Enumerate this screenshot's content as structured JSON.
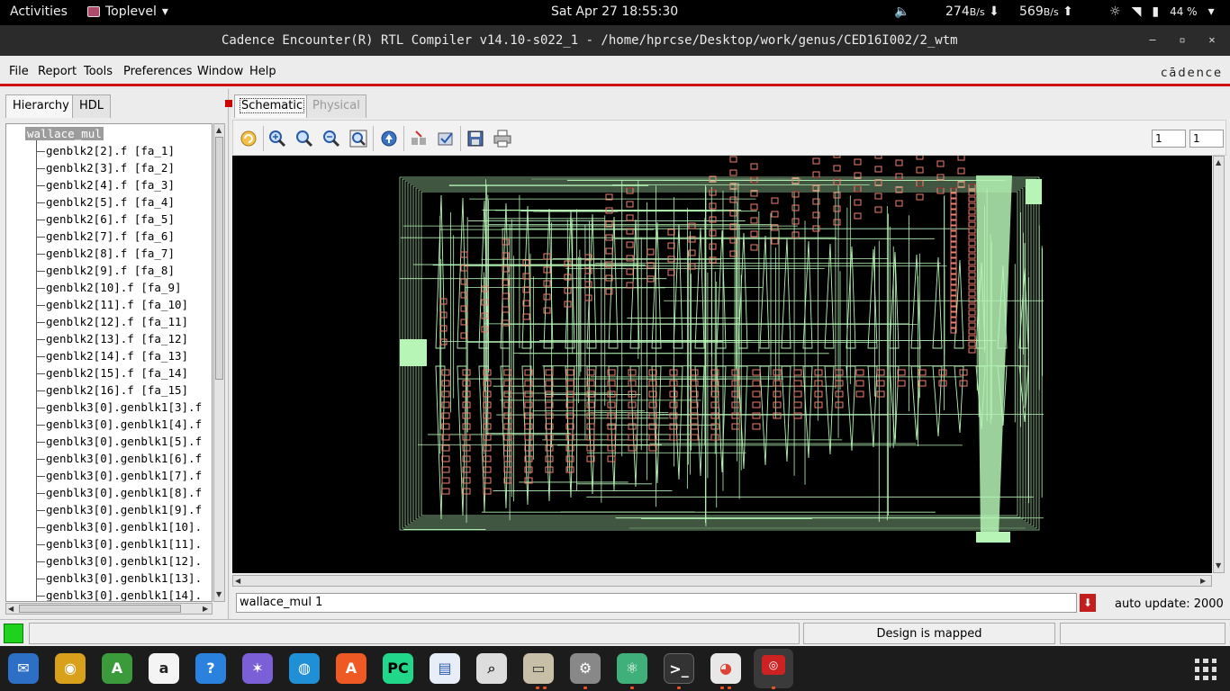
{
  "topbar": {
    "activities": "Activities",
    "app_menu": "Toplevel",
    "clock": "Sat Apr 27  18:55:30",
    "net_down": "274",
    "net_down_unit": "B/s",
    "net_up": "569",
    "net_up_unit": "B/s",
    "battery": "44 %"
  },
  "window": {
    "title": "Cadence Encounter(R) RTL Compiler v14.10-s022_1 - /home/hprcse/Desktop/work/genus/CED16I002/2_wtm"
  },
  "menubar": {
    "file": "File",
    "report": "Report",
    "tools": "Tools",
    "preferences": "Preferences",
    "window": "Window",
    "help": "Help",
    "logo": "cādence"
  },
  "left_panel": {
    "tabs": [
      "Hierarchy",
      "HDL"
    ],
    "root": "wallace_mul",
    "nodes": [
      "genblk2[2].f [fa_1]",
      "genblk2[3].f [fa_2]",
      "genblk2[4].f [fa_3]",
      "genblk2[5].f [fa_4]",
      "genblk2[6].f [fa_5]",
      "genblk2[7].f [fa_6]",
      "genblk2[8].f [fa_7]",
      "genblk2[9].f [fa_8]",
      "genblk2[10].f [fa_9]",
      "genblk2[11].f [fa_10]",
      "genblk2[12].f [fa_11]",
      "genblk2[13].f [fa_12]",
      "genblk2[14].f [fa_13]",
      "genblk2[15].f [fa_14]",
      "genblk2[16].f [fa_15]",
      "genblk3[0].genblk1[3].f",
      "genblk3[0].genblk1[4].f",
      "genblk3[0].genblk1[5].f",
      "genblk3[0].genblk1[6].f",
      "genblk3[0].genblk1[7].f",
      "genblk3[0].genblk1[8].f",
      "genblk3[0].genblk1[9].f",
      "genblk3[0].genblk1[10].",
      "genblk3[0].genblk1[11].",
      "genblk3[0].genblk1[12].",
      "genblk3[0].genblk1[13].",
      "genblk3[0].genblk1[14]."
    ]
  },
  "right_panel": {
    "tabs": [
      "Schematic",
      "Physical"
    ],
    "spin1": "1",
    "spin2": "1",
    "command": "wallace_mul 1",
    "auto_update": "auto update: 2000"
  },
  "statusbar": {
    "message": "Design is mapped"
  },
  "colors": {
    "wire": "#b6f5b6",
    "cell": "#f08070",
    "canvas": "#000000",
    "accent_red": "#d01010"
  },
  "icons": [
    "refresh-icon",
    "zoom-in-icon",
    "zoom-icon",
    "zoom-out-icon",
    "zoom-fit-icon",
    "go-up-icon",
    "select-icon",
    "check-icon",
    "save-icon",
    "print-icon"
  ]
}
